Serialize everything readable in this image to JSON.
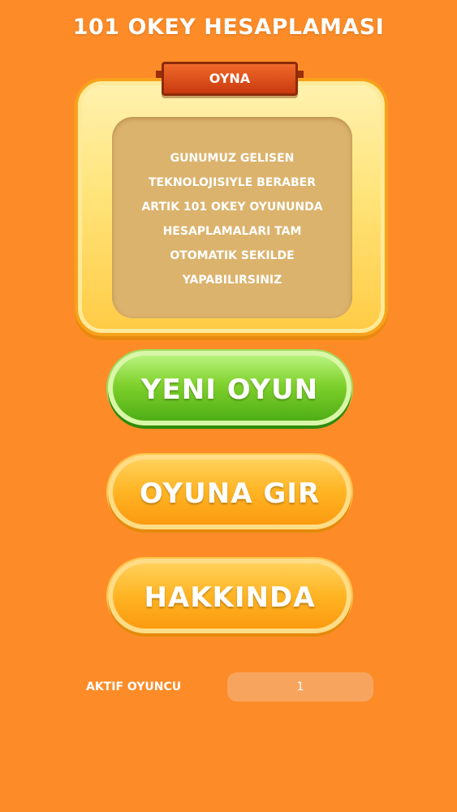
{
  "app": {
    "title": "101 OKEY HESAPLAMASI"
  },
  "panel": {
    "ribbon_label": "OYNA",
    "description": "GUNUMUZ GELISEN\nTEKNOLOJISIYLE BERABER\nARTIK 101 OKEY OYUNUNDA\nHESAPLAMALARI TAM\nOTOMATIK SEKILDE\nYAPABILIRSINIZ"
  },
  "buttons": {
    "new_game": "YENI OYUN",
    "join_game": "OYUNA GIR",
    "about": "HAKKINDA"
  },
  "active_player": {
    "label": "AKTIF OYUNCU",
    "value": "1"
  },
  "colors": {
    "background": "#fd8c28",
    "green_button": "#7fd12c",
    "orange_button": "#ffb423",
    "ribbon": "#d9451a",
    "panel_inner": "#dbb36d"
  }
}
